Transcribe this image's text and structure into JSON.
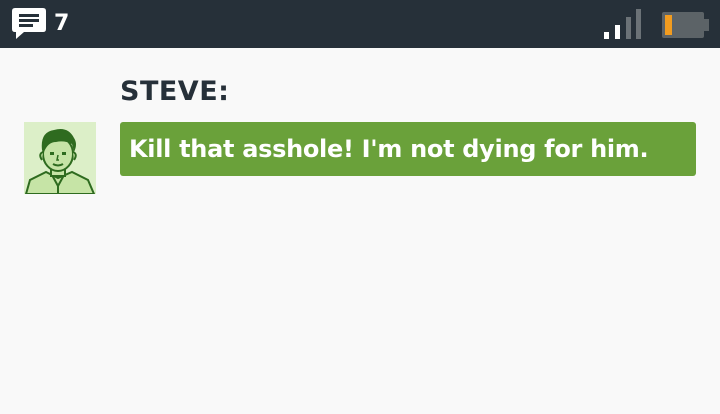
{
  "status_bar": {
    "unread_messages_icon": "chat-bubble-icon",
    "unread_count": "7",
    "signal_icon": "signal-strength-icon",
    "signal_bars_active": 2,
    "signal_bars_total": 4,
    "battery_icon": "battery-icon",
    "battery_level_fraction": 0.1
  },
  "conversation": {
    "speaker": "STEVE:",
    "avatar_icon": "steve-portrait",
    "message": "Kill that asshole! I'm not dying for him."
  },
  "colors": {
    "status_bar_bg": "#263039",
    "bubble_bg": "#6aa13a",
    "avatar_bg": "#dcefc8",
    "battery_low": "#f29c1f"
  }
}
